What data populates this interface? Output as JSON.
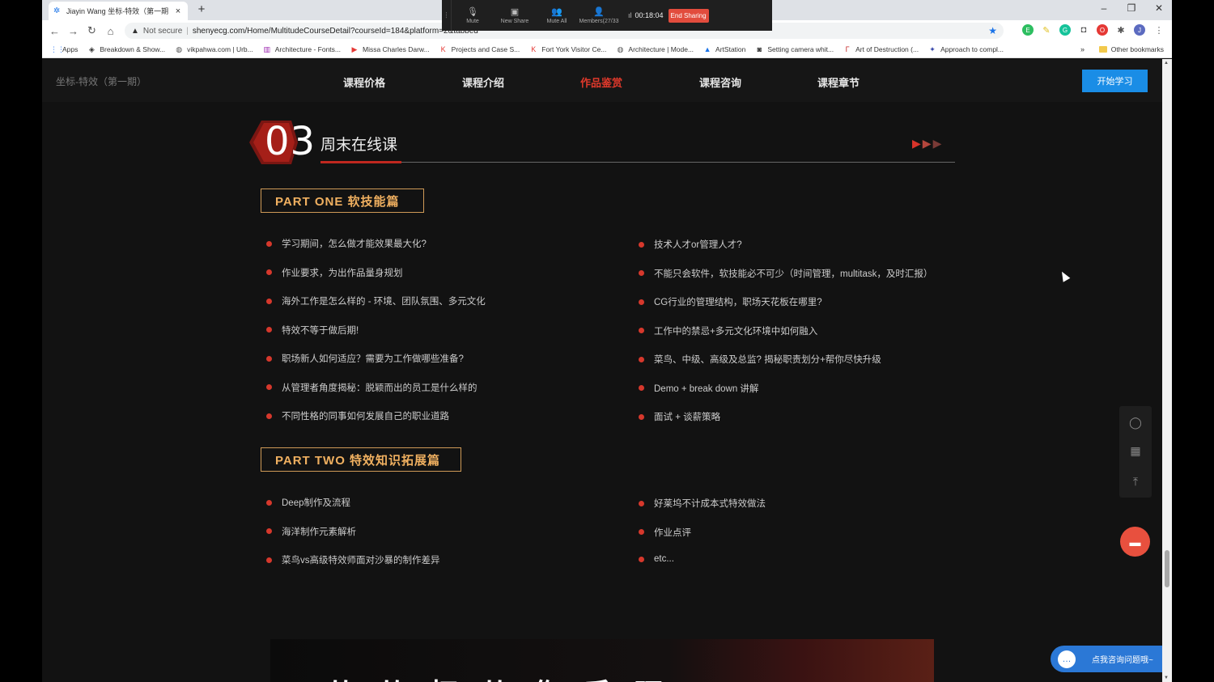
{
  "browser": {
    "tab": {
      "title": "Jiayin Wang 坐标-特效（第一期",
      "close": "×"
    },
    "new_tab": "+",
    "window_controls": {
      "minimize": "–",
      "maximize": "❐",
      "close": "✕"
    },
    "address": {
      "warning": "▲",
      "not_secure": "Not secure",
      "separator": "|",
      "url": "shenyecg.com/Home/MultitudeCourseDetail?courseId=184&platform=2&tabbed"
    },
    "nav": {
      "back": "←",
      "forward": "→",
      "reload": "↻",
      "home": "⌂",
      "star": "★"
    },
    "extensions": [
      {
        "icon": "evernote-icon",
        "label": "E",
        "color": "#2dbe60"
      },
      {
        "icon": "marker-icon",
        "label": "✎",
        "color": "#e0c020"
      },
      {
        "icon": "grammarly-icon",
        "label": "G",
        "color": "#15c39a"
      },
      {
        "icon": "shield-icon",
        "label": "◘",
        "color": "#555555"
      },
      {
        "icon": "adblock-icon",
        "label": "O",
        "color": "#e53935"
      },
      {
        "icon": "puzzle-icon",
        "label": "✱",
        "color": "#555555"
      },
      {
        "icon": "profile-avatar",
        "label": "J",
        "color": "#5c6bc0"
      },
      {
        "icon": "menu-icon",
        "label": "⋮",
        "color": "#555555"
      }
    ],
    "bookmarks": [
      {
        "icon": "apps-icon",
        "label": "Apps"
      },
      {
        "icon": "vfx-icon",
        "label": "Breakdown & Show..."
      },
      {
        "icon": "globe-icon",
        "label": "vikpahwa.com | Urb..."
      },
      {
        "icon": "building-icon",
        "label": "Architecture - Fonts..."
      },
      {
        "icon": "youtube-icon",
        "label": "Missa Charles Darw..."
      },
      {
        "icon": "km-icon",
        "label": "Projects and Case S..."
      },
      {
        "icon": "km-icon",
        "label": "Fort York Visitor Ce..."
      },
      {
        "icon": "globe-icon",
        "label": "Architecture | Mode..."
      },
      {
        "icon": "artstation-icon",
        "label": "ArtStation"
      },
      {
        "icon": "camera-icon",
        "label": "Setting camera whit..."
      },
      {
        "icon": "aod-icon",
        "label": "Art of Destruction (..."
      },
      {
        "icon": "approach-icon",
        "label": "Approach to compl..."
      }
    ],
    "bookmarks_more": "»",
    "other_bookmarks": "Other bookmarks"
  },
  "zoom": {
    "buttons": [
      {
        "icon": "microphone-icon",
        "glyph": "🎙",
        "label": "Mute"
      },
      {
        "icon": "screen-share-icon",
        "glyph": "▣",
        "label": "New Share"
      },
      {
        "icon": "mute-all-icon",
        "glyph": "👥",
        "label": "Mute All"
      },
      {
        "icon": "members-icon",
        "glyph": "👤",
        "label": "Members(27/33"
      }
    ],
    "signal": "ıl",
    "timer": "00:18:04",
    "end_label": "End Sharing"
  },
  "site": {
    "brand": "坐标-特效（第一期）",
    "nav": [
      {
        "label": "课程价格",
        "active": false
      },
      {
        "label": "课程介绍",
        "active": false
      },
      {
        "label": "作品鉴赏",
        "active": true
      },
      {
        "label": "课程咨询",
        "active": false
      },
      {
        "label": "课程章节",
        "active": false
      }
    ],
    "start_button": "开始学习"
  },
  "section": {
    "number": "03",
    "title": "周末在线课",
    "arrows": [
      "▶",
      "▶",
      "▶"
    ],
    "arrow_colors": [
      "#d8342a",
      "#b4463c",
      "#7a3a36"
    ]
  },
  "part_one": {
    "label": "PART ONE  软技能篇",
    "left": [
      "学习期间，怎么做才能效果最大化?",
      "作业要求，为出作品量身规划",
      "海外工作是怎么样的 - 环境、团队氛围、多元文化",
      "特效不等于做后期!",
      "职场新人如何适应？需要为工作做哪些准备?",
      "从管理者角度揭秘：脱颖而出的员工是什么样的",
      "不同性格的同事如何发展自己的职业道路"
    ],
    "right": [
      "技术人才or管理人才?",
      "不能只会软件，软技能必不可少（时间管理，multitask，及时汇报）",
      "CG行业的管理结构，职场天花板在哪里?",
      "工作中的禁忌+多元文化环境中如何融入",
      "菜鸟、中级、高级及总监? 揭秘职责划分+帮你尽快升级",
      "Demo + break down 讲解",
      "面试 + 谈薪策略"
    ]
  },
  "part_two": {
    "label": "PART TWO  特效知识拓展篇",
    "left": [
      "Deep制作及流程",
      "海洋制作元素解析",
      "菜鸟vs高级特效师面对沙暴的制作差异"
    ],
    "right": [
      "好莱坞不计成本式特效做法",
      "作业点评",
      "etc..."
    ]
  },
  "side_tools": {
    "qq": "◯",
    "qrcode": "▦",
    "top": "⤒",
    "chat": "▬"
  },
  "consult": {
    "icon": "chat-bubble-icon",
    "glyph": "…",
    "label": "点我咨询问题哦~"
  },
  "banner": {
    "text": "从 从 打 从 作 手 环"
  },
  "colors": {
    "accent": "#e0392b",
    "gold": "#f0b060",
    "blue": "#1a8de6"
  }
}
